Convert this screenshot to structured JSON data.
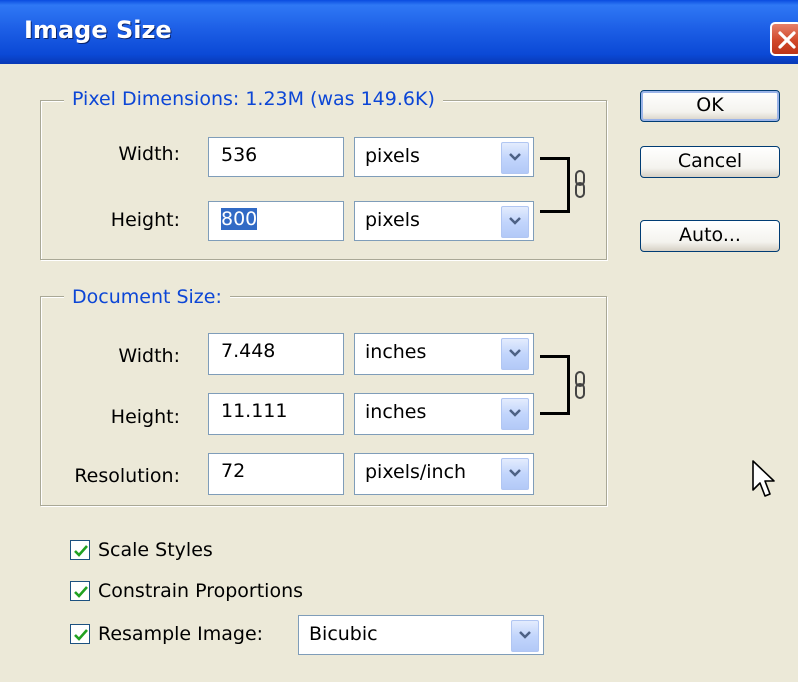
{
  "window": {
    "title": "Image Size"
  },
  "pixel_dimensions": {
    "legend": "Pixel Dimensions:  1.23M (was 149.6K)",
    "width_label": "Width:",
    "width_value": "536",
    "width_unit": "pixels",
    "height_label": "Height:",
    "height_value": "800",
    "height_unit": "pixels"
  },
  "document_size": {
    "legend": "Document Size:",
    "width_label": "Width:",
    "width_value": "7.448",
    "width_unit": "inches",
    "height_label": "Height:",
    "height_value": "11.111",
    "height_unit": "inches",
    "resolution_label": "Resolution:",
    "resolution_value": "72",
    "resolution_unit": "pixels/inch"
  },
  "buttons": {
    "ok": "OK",
    "cancel": "Cancel",
    "auto": "Auto..."
  },
  "options": {
    "scale_styles": {
      "label": "Scale Styles",
      "checked": true
    },
    "constrain_proportions": {
      "label": "Constrain Proportions",
      "checked": true
    },
    "resample_image": {
      "label": "Resample Image:",
      "checked": true,
      "method": "Bicubic"
    }
  },
  "colors": {
    "titlebar": "#0b49d6",
    "legend_text": "#0c46d6",
    "dialog_bg": "#ece9d8",
    "close_button": "#d1492a"
  },
  "icons": [
    "close-icon",
    "dropdown-arrow-icon",
    "chain-link-icon",
    "checkmark-icon",
    "mouse-pointer-icon"
  ]
}
